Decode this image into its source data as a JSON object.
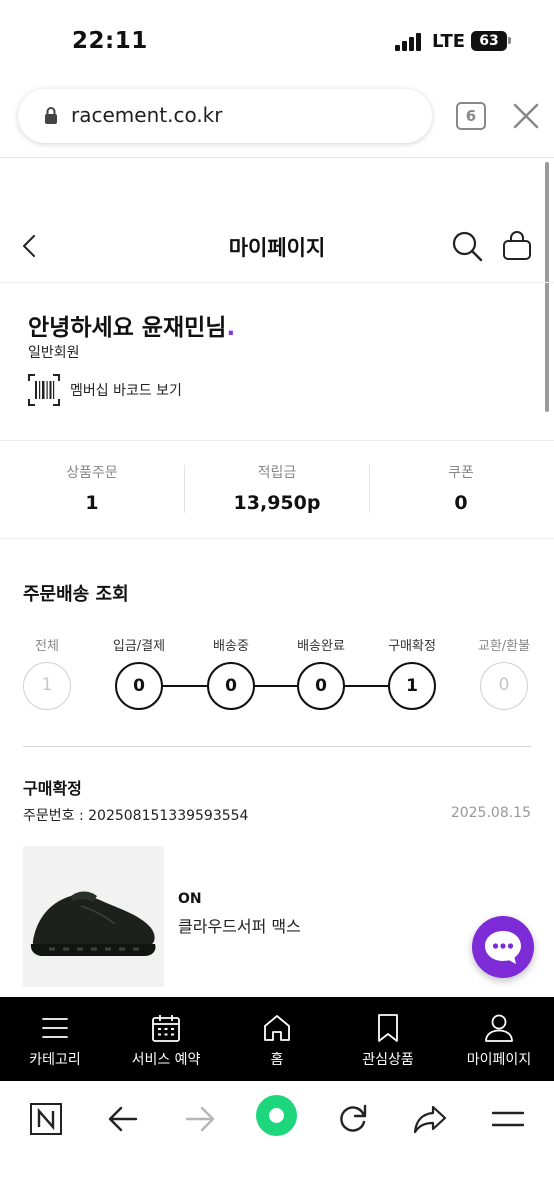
{
  "status_bar": {
    "time": "22:11",
    "network": "LTE",
    "battery": "63"
  },
  "browser": {
    "url": "racement.co.kr",
    "tab_count": "6"
  },
  "header": {
    "title": "마이페이지"
  },
  "profile": {
    "greeting": "안녕하세요 윤재민님",
    "greeting_dot": ".",
    "grade": "일반회원",
    "barcode_label": "멤버십 바코드 보기"
  },
  "stats": [
    {
      "label": "상품주문",
      "value": "1"
    },
    {
      "label": "적립금",
      "value": "13,950p"
    },
    {
      "label": "쿠폰",
      "value": "0"
    }
  ],
  "tracking": {
    "title": "주문배송 조회",
    "steps": [
      {
        "label": "전체",
        "count": "1"
      },
      {
        "label": "입금/결제",
        "count": "0"
      },
      {
        "label": "배송중",
        "count": "0"
      },
      {
        "label": "배송완료",
        "count": "0"
      },
      {
        "label": "구매확정",
        "count": "1"
      },
      {
        "label": "교환/환불",
        "count": "0"
      }
    ]
  },
  "order": {
    "status": "구매확정",
    "order_number": "주문번호 : 2025081513395935​54",
    "date": "2025.08.15",
    "brand": "ON",
    "product_name": "클라우드서퍼 맥스"
  },
  "tabbar": [
    {
      "label": "카테고리",
      "icon": "menu-icon"
    },
    {
      "label": "서비스 예약",
      "icon": "calendar-icon"
    },
    {
      "label": "홈",
      "icon": "home-icon"
    },
    {
      "label": "관심상품",
      "icon": "bookmark-icon"
    },
    {
      "label": "마이페이지",
      "icon": "person-icon"
    }
  ],
  "colors": {
    "accent": "#7c2bd6",
    "green": "#1ed67c",
    "tabbar_bg": "#000000"
  }
}
